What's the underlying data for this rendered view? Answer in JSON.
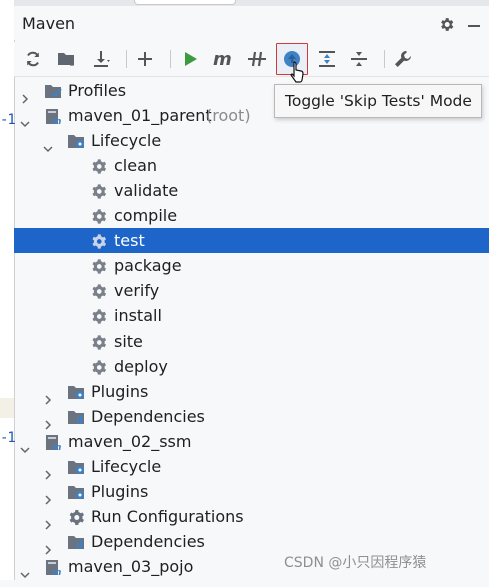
{
  "panel": {
    "title": "Maven"
  },
  "tooltip": {
    "text": "Toggle 'Skip Tests' Mode"
  },
  "editor_marks": [
    "-1",
    "-1"
  ],
  "tree": [
    {
      "label": "Profiles",
      "suffix": "",
      "level": 0,
      "expanded": false,
      "icon": "profiles-icon",
      "selected": false
    },
    {
      "label": "maven_01_parent",
      "suffix": "(root)",
      "level": 0,
      "expanded": true,
      "icon": "maven-module-icon",
      "selected": false
    },
    {
      "label": "Lifecycle",
      "suffix": "",
      "level": 1,
      "expanded": true,
      "icon": "lifecycle-folder-icon",
      "selected": false
    },
    {
      "label": "clean",
      "suffix": "",
      "level": 2,
      "expanded": null,
      "icon": "gear-icon",
      "selected": false
    },
    {
      "label": "validate",
      "suffix": "",
      "level": 2,
      "expanded": null,
      "icon": "gear-icon",
      "selected": false
    },
    {
      "label": "compile",
      "suffix": "",
      "level": 2,
      "expanded": null,
      "icon": "gear-icon",
      "selected": false
    },
    {
      "label": "test",
      "suffix": "",
      "level": 2,
      "expanded": null,
      "icon": "gear-icon",
      "selected": true
    },
    {
      "label": "package",
      "suffix": "",
      "level": 2,
      "expanded": null,
      "icon": "gear-icon",
      "selected": false
    },
    {
      "label": "verify",
      "suffix": "",
      "level": 2,
      "expanded": null,
      "icon": "gear-icon",
      "selected": false
    },
    {
      "label": "install",
      "suffix": "",
      "level": 2,
      "expanded": null,
      "icon": "gear-icon",
      "selected": false
    },
    {
      "label": "site",
      "suffix": "",
      "level": 2,
      "expanded": null,
      "icon": "gear-icon",
      "selected": false
    },
    {
      "label": "deploy",
      "suffix": "",
      "level": 2,
      "expanded": null,
      "icon": "gear-icon",
      "selected": false
    },
    {
      "label": "Plugins",
      "suffix": "",
      "level": 1,
      "expanded": false,
      "icon": "plugins-folder-icon",
      "selected": false
    },
    {
      "label": "Dependencies",
      "suffix": "",
      "level": 1,
      "expanded": false,
      "icon": "dependencies-icon",
      "selected": false
    },
    {
      "label": "maven_02_ssm",
      "suffix": "",
      "level": 0,
      "expanded": true,
      "icon": "maven-module-icon",
      "selected": false
    },
    {
      "label": "Lifecycle",
      "suffix": "",
      "level": 1,
      "expanded": false,
      "icon": "lifecycle-folder-icon",
      "selected": false
    },
    {
      "label": "Plugins",
      "suffix": "",
      "level": 1,
      "expanded": false,
      "icon": "plugins-folder-icon",
      "selected": false
    },
    {
      "label": "Run Configurations",
      "suffix": "",
      "level": 1,
      "expanded": false,
      "icon": "run-config-icon",
      "selected": false
    },
    {
      "label": "Dependencies",
      "suffix": "",
      "level": 1,
      "expanded": false,
      "icon": "dependencies-icon",
      "selected": false
    },
    {
      "label": "maven_03_pojo",
      "suffix": "",
      "level": 0,
      "expanded": true,
      "icon": "maven-module-icon",
      "selected": false
    }
  ],
  "watermark": "CSDN @小只因程序猿",
  "colors": {
    "selection": "#1e65c9",
    "highlight_border": "#d23a3a",
    "run_green": "#3c9a41",
    "blue_accent": "#3e82c6"
  }
}
